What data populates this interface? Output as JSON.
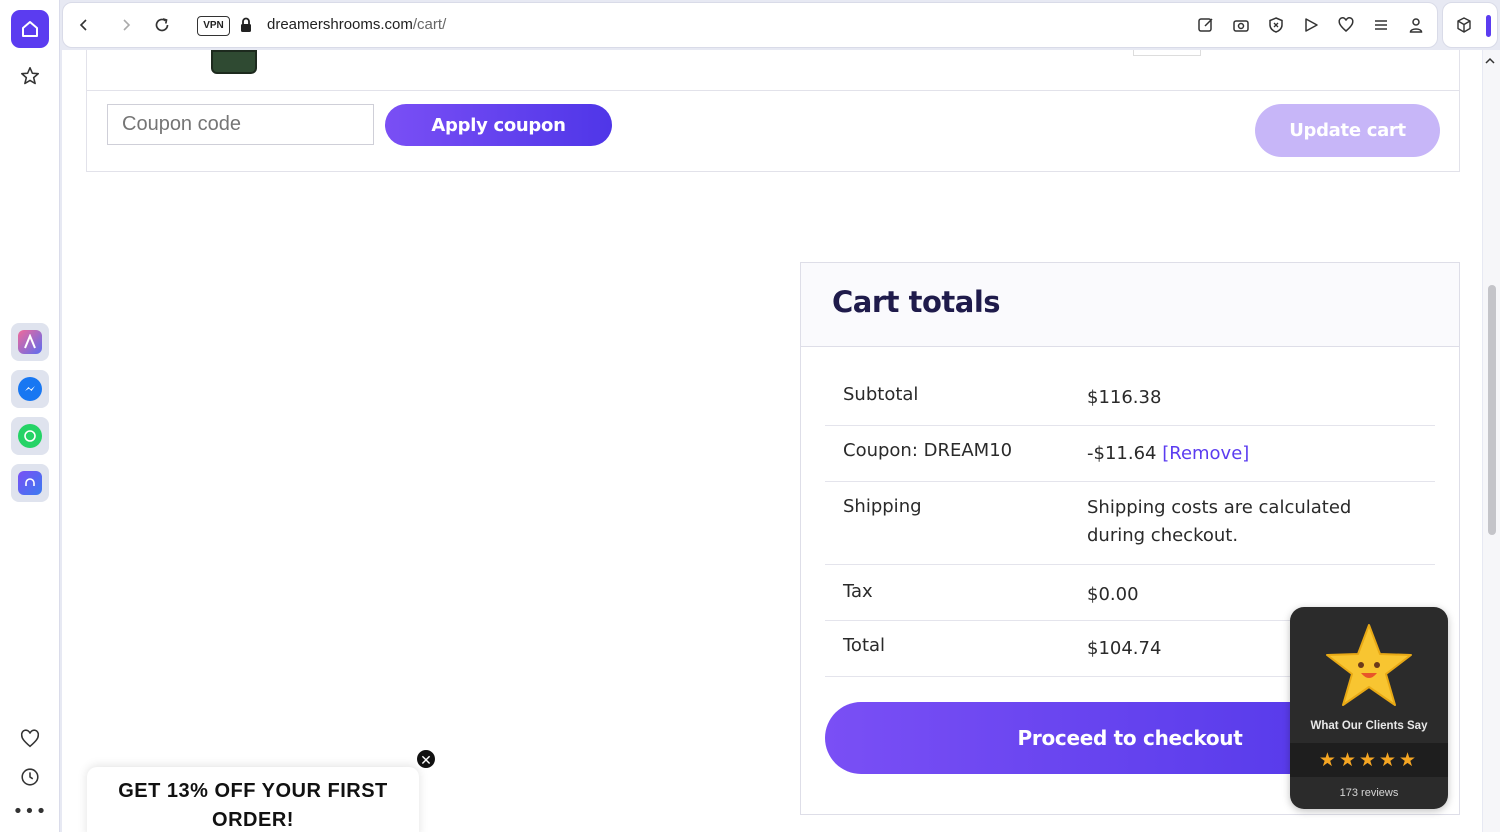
{
  "browser": {
    "vpn_label": "VPN",
    "url_domain": "dreamershrooms.com",
    "url_path": "/cart/",
    "accent_color": "#5b3cf0"
  },
  "sidebar": {
    "icons": [
      "home-icon",
      "star-icon",
      "aria-app-icon",
      "messenger-icon",
      "whatsapp-icon",
      "player-icon",
      "heart-icon",
      "history-icon",
      "more-icon"
    ],
    "more_label": "•••"
  },
  "toolbar_icons": [
    "edit-icon",
    "camera-icon",
    "shield-icon",
    "send-icon",
    "heart-icon",
    "menu-icon",
    "profile-icon"
  ],
  "cart": {
    "coupon_placeholder": "Coupon code",
    "apply_coupon_label": "Apply coupon",
    "update_cart_label": "Update cart"
  },
  "totals": {
    "title": "Cart totals",
    "rows": [
      {
        "label": "Subtotal",
        "value": "$116.38"
      },
      {
        "label": "Coupon: DREAM10",
        "value": "-$11.64",
        "link": "[Remove]"
      },
      {
        "label": "Shipping",
        "value": "Shipping costs are calculated during checkout."
      },
      {
        "label": "Tax",
        "value": "$0.00"
      },
      {
        "label": "Total",
        "value": "$104.74"
      }
    ],
    "checkout_label": "Proceed to checkout"
  },
  "reviews_widget": {
    "title": "What Our Clients Say",
    "stars": "★★★★★",
    "rating": 5,
    "count": "173 reviews"
  },
  "promo": {
    "text": "GET 13% OFF YOUR FIRST ORDER!",
    "close_label": "✕"
  }
}
